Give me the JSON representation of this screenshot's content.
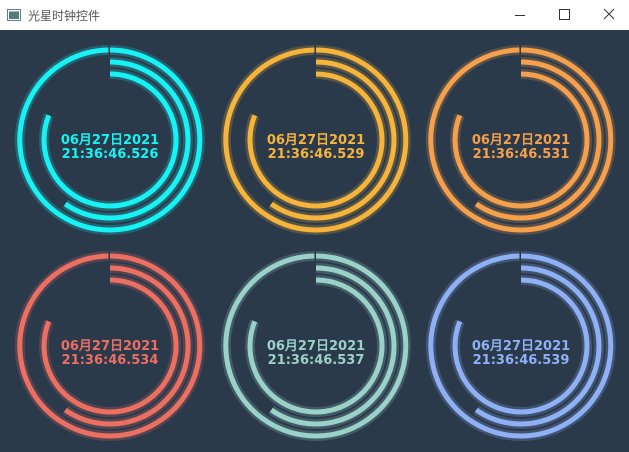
{
  "window": {
    "title": "光星时钟控件"
  },
  "clocks": [
    {
      "date": "06月27日2021",
      "time": "21:36:46.526",
      "color": "#17f3f4"
    },
    {
      "date": "06月27日2021",
      "time": "21:36:46.529",
      "color": "#f7b43a"
    },
    {
      "date": "06月27日2021",
      "time": "21:36:46.531",
      "color": "#f6a04c"
    },
    {
      "date": "06月27日2021",
      "time": "21:36:46.534",
      "color": "#ec6f62"
    },
    {
      "date": "06月27日2021",
      "time": "21:36:46.537",
      "color": "#9ad1c9"
    },
    {
      "date": "06月27日2021",
      "time": "21:36:46.539",
      "color": "#8fb0f5"
    }
  ]
}
